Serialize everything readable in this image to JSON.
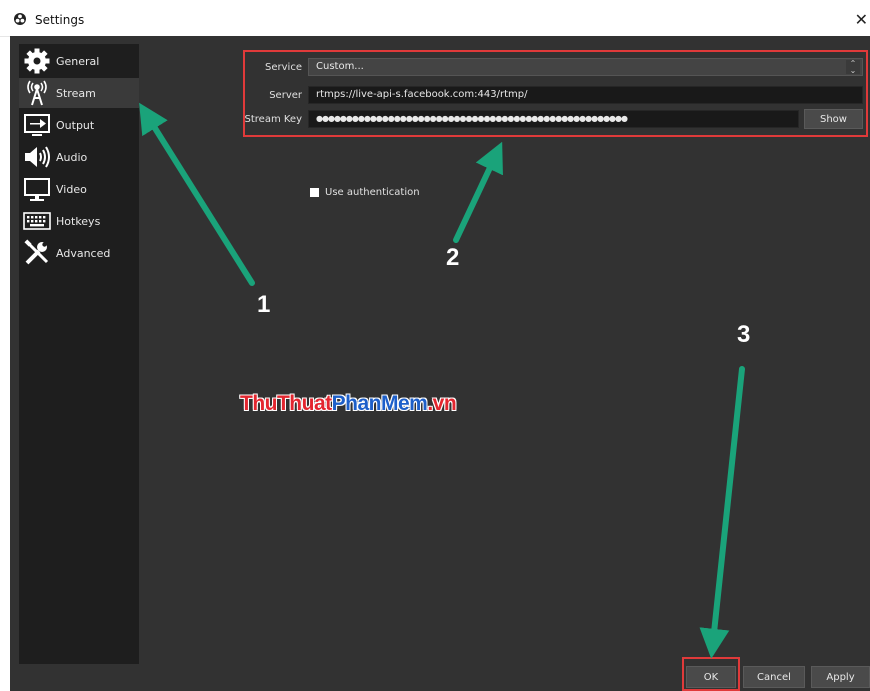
{
  "window": {
    "title": "Settings",
    "close_glyph": "✕"
  },
  "sidebar": {
    "items": [
      {
        "label": "General",
        "icon": "gear-icon"
      },
      {
        "label": "Stream",
        "icon": "broadcast-antenna-icon",
        "active": true
      },
      {
        "label": "Output",
        "icon": "output-icon"
      },
      {
        "label": "Audio",
        "icon": "speaker-icon"
      },
      {
        "label": "Video",
        "icon": "monitor-icon"
      },
      {
        "label": "Hotkeys",
        "icon": "keyboard-icon"
      },
      {
        "label": "Advanced",
        "icon": "tools-icon"
      }
    ]
  },
  "stream": {
    "service_label": "Service",
    "service_value": "Custom...",
    "server_label": "Server",
    "server_value": "rtmps://live-api-s.facebook.com:443/rtmp/",
    "key_label": "Stream Key",
    "key_value": "●●●●●●●●●●●●●●●●●●●●●●●●●●●●●●●●●●●●●●●●●●●●●●●●●●●●",
    "show_label": "Show",
    "auth_label": "Use authentication",
    "auth_checked": false
  },
  "footer": {
    "ok_label": "OK",
    "cancel_label": "Cancel",
    "apply_label": "Apply"
  },
  "annotations": {
    "n1": "1",
    "n2": "2",
    "n3": "3",
    "arrow_color": "#1aa37a",
    "highlight_color": "#e03a3a"
  },
  "watermark": {
    "part1": "ThuThuat",
    "part2": "PhanMem",
    "part3": ".vn"
  }
}
